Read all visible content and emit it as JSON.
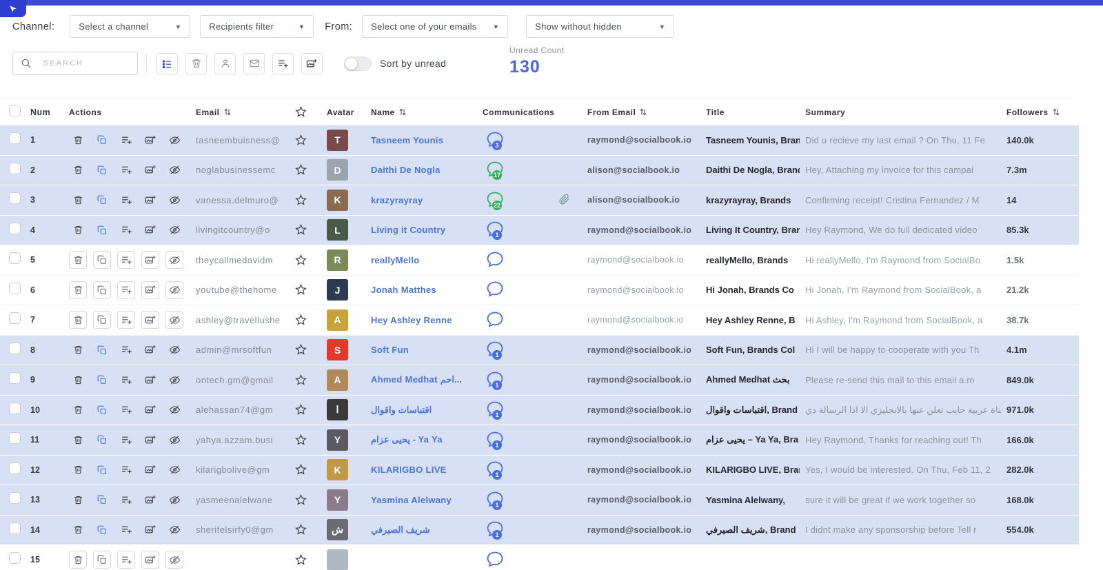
{
  "colors": {
    "accent_blue": "#3b55d9",
    "unread_row_bg": "#d8e0f5",
    "badge_blue": "#4a6ee0",
    "badge_green": "#2fb45a"
  },
  "topbar": {
    "channel_label": "Channel:",
    "channel_value": "Select a channel",
    "recipients_value": "Recipients filter",
    "from_label": "From:",
    "from_value": "Select one of your emails",
    "hidden_value": "Show without hidden"
  },
  "toolbar": {
    "search_placeholder": "SEARCH",
    "icon_buttons": [
      "filter-list-icon",
      "delete-icon",
      "contact-icon",
      "mail-icon",
      "playlist-add-icon",
      "image-add-icon"
    ],
    "sort_toggle_label": "Sort by unread",
    "unread_count_label": "Unread Count",
    "unread_count_value": "130"
  },
  "table": {
    "headers": {
      "num": "Num",
      "actions": "Actions",
      "email": "Email",
      "avatar": "Avatar",
      "name": "Name",
      "communications": "Communications",
      "from_email": "From Email",
      "title": "Title",
      "summary": "Summary",
      "followers": "Followers"
    },
    "row_action_icons": [
      "delete-icon",
      "copy-icon",
      "playlist-add-icon",
      "image-add-icon",
      "hide-icon"
    ],
    "rows": [
      {
        "num": "1",
        "email": "tasneembuisness@",
        "name": "Tasneem Younis",
        "comm_count": "3",
        "comm_color": "blue",
        "attachment": false,
        "from_email": "raymond@socialbook.io",
        "title": "Tasneem Younis, Brands",
        "summary": "Did u recieve my last email ? On Thu, 11 Fe",
        "followers": "140.0k",
        "unread": true,
        "avatar": {
          "color": "#7a4a4a",
          "initial": "T"
        }
      },
      {
        "num": "2",
        "email": "noglabusinessemc",
        "name": "Daithi De Nogla",
        "comm_count": "17",
        "comm_color": "green",
        "attachment": false,
        "from_email": "alison@socialbook.io",
        "title": "Daithi De Nogla, Brand",
        "summary": "Hey, Attaching my invoice for this campai",
        "followers": "7.3m",
        "unread": true,
        "avatar": {
          "color": "#9aa4b0",
          "initial": "D"
        }
      },
      {
        "num": "3",
        "email": "vanessa.delmuro@",
        "name": "krazyrayray",
        "comm_count": "22",
        "comm_color": "green",
        "attachment": true,
        "from_email": "alison@socialbook.io",
        "title": "krazyrayray, Brands",
        "summary": "Confirming receipt! Cristina Fernandez / M",
        "followers": "14",
        "unread": true,
        "avatar": {
          "color": "#8a6a52",
          "initial": "K"
        }
      },
      {
        "num": "4",
        "email": "livingitcountry@o",
        "name": "Living it Country",
        "comm_count": "1",
        "comm_color": "blue",
        "attachment": false,
        "from_email": "raymond@socialbook.io",
        "title": "Living It Country, Brand",
        "summary": "Hey Raymond, We do full dedicated video",
        "followers": "85.3k",
        "unread": true,
        "avatar": {
          "color": "#4a5a48",
          "initial": "L"
        }
      },
      {
        "num": "5",
        "email": "theycallmedavidm",
        "name": "reallyMello",
        "comm_count": "",
        "comm_color": "blue",
        "attachment": false,
        "from_email": "raymond@socialbook.io",
        "title": "reallyMello, Brands",
        "summary": "Hi reallyMello, I'm Raymond from SocialBo",
        "followers": "1.5k",
        "unread": false,
        "avatar": {
          "color": "#7a8a5a",
          "initial": "R"
        }
      },
      {
        "num": "6",
        "email": "youtube@thehome",
        "name": "Jonah Matthes",
        "comm_count": "",
        "comm_color": "blue",
        "attachment": false,
        "from_email": "raymond@socialbook.io",
        "title": "Hi Jonah, Brands Co",
        "summary": "Hi Jonah, I'm Raymond from SocialBook, a",
        "followers": "21.2k",
        "unread": false,
        "avatar": {
          "color": "#2e3a52",
          "initial": "J"
        }
      },
      {
        "num": "7",
        "email": "ashley@travellushe",
        "name": "Hey Ashley Renne",
        "comm_count": "",
        "comm_color": "blue",
        "attachment": false,
        "from_email": "raymond@socialbook.io",
        "title": "Hey Ashley Renne, B",
        "summary": "Hi Ashley, I'm Raymond from SocialBook, a",
        "followers": "38.7k",
        "unread": false,
        "avatar": {
          "color": "#c8a23a",
          "initial": "A"
        }
      },
      {
        "num": "8",
        "email": "admin@mrsoftfun",
        "name": "Soft Fun",
        "comm_count": "1",
        "comm_color": "blue",
        "attachment": false,
        "from_email": "raymond@socialbook.io",
        "title": "Soft Fun, Brands Col",
        "summary": "Hi I will be happy to cooperate with you Th",
        "followers": "4.1m",
        "unread": true,
        "avatar": {
          "color": "#e03a2a",
          "initial": "S"
        }
      },
      {
        "num": "9",
        "email": "ontech.gm@gmail",
        "name": "Ahmed Medhat احم...",
        "comm_count": "1",
        "comm_color": "blue",
        "attachment": false,
        "from_email": "raymond@socialbook.io",
        "title": "Ahmed Medhat بحث",
        "summary": "Please re-send this mail to this email a.m",
        "followers": "849.0k",
        "unread": true,
        "avatar": {
          "color": "#b08a5a",
          "initial": "A"
        }
      },
      {
        "num": "10",
        "email": "alehassan74@gm",
        "name": "اقتباسات واقوال",
        "comm_count": "1",
        "comm_color": "blue",
        "attachment": false,
        "from_email": "raymond@socialbook.io",
        "title": "اقتباسات واقوال, Brand",
        "summary": "قناة عربية حابب تعلن عنها بالانجليزي الا اذا الرسالة دي",
        "followers": "971.0k",
        "unread": true,
        "avatar": {
          "color": "#3a3a3a",
          "initial": "ا"
        }
      },
      {
        "num": "11",
        "email": "yahya.azzam.busi",
        "name": "يحيى عزام - Ya Ya",
        "comm_count": "1",
        "comm_color": "blue",
        "attachment": false,
        "from_email": "raymond@socialbook.io",
        "title": "يحيى عزام – Ya Ya, Bra",
        "summary": "Hey Raymond, Thanks for reaching out! Th",
        "followers": "166.0k",
        "unread": true,
        "avatar": {
          "color": "#5a5a62",
          "initial": "Y"
        }
      },
      {
        "num": "12",
        "email": "kilarigbolive@gm",
        "name": "KILARIGBO LIVE",
        "comm_count": "1",
        "comm_color": "blue",
        "attachment": false,
        "from_email": "raymond@socialbook.io",
        "title": "KILARIGBO LIVE, Bran",
        "summary": "Yes, I would be interested. On Thu, Feb 11, 2",
        "followers": "282.0k",
        "unread": true,
        "avatar": {
          "color": "#c09a4a",
          "initial": "K"
        }
      },
      {
        "num": "13",
        "email": "yasmeenalelwane",
        "name": "Yasmina Alelwany",
        "comm_count": "1",
        "comm_color": "blue",
        "attachment": false,
        "from_email": "raymond@socialbook.io",
        "title": "Yasmina Alelwany,",
        "summary": "sure it will be great if we work together so",
        "followers": "168.0k",
        "unread": true,
        "avatar": {
          "color": "#8a7a8a",
          "initial": "Y"
        }
      },
      {
        "num": "14",
        "email": "sherifelsirfy0@gm",
        "name": "شريف الصيرفي",
        "comm_count": "1",
        "comm_color": "blue",
        "attachment": false,
        "from_email": "raymond@socialbook.io",
        "title": "شريف الصيرفي, Brand",
        "summary": "I didnt make any sponsorship before Tell r",
        "followers": "554.0k",
        "unread": true,
        "avatar": {
          "color": "#6a6a72",
          "initial": "ش"
        }
      },
      {
        "num": "15",
        "email": "",
        "name": "",
        "comm_count": "",
        "comm_color": "blue",
        "attachment": false,
        "from_email": "",
        "title": "",
        "summary": "",
        "followers": "",
        "unread": false,
        "avatar": {
          "color": "#b0b8c4",
          "initial": ""
        }
      }
    ]
  }
}
